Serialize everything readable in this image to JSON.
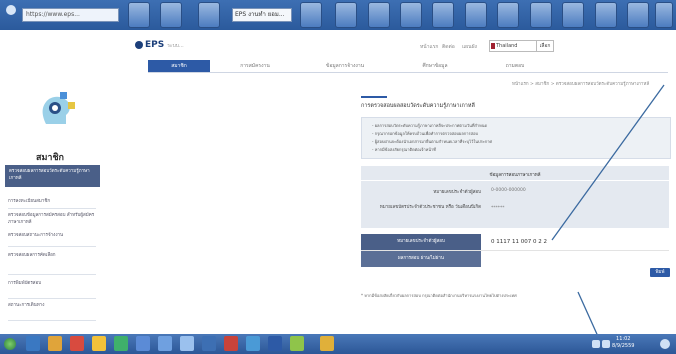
{
  "browser": {
    "address_text": "https://www.eps...",
    "tab_text": "EPS งานทำ ยอม..."
  },
  "header": {
    "logo_text": "EPS",
    "logo_sub": "ระบบ...",
    "links": [
      "หน้าแรก",
      "ติดต่อ",
      "แผนผัง"
    ],
    "language": "Thailand",
    "language_button": "เลือก"
  },
  "nav": {
    "items": [
      "สมาชิก",
      "การสมัครงาน",
      "ข้อมูลการจ้างงาน",
      "ศึกษาข้อมูล",
      "ถามตอบ"
    ]
  },
  "breadcrumb": "หน้าแรก > สมาชิก > ตรวจสอบผลการสอบวัดระดับความรู้ภาษาเกาหลี",
  "sidebar": {
    "heading": "สมาชิก",
    "active_item": "ตรวจสอบผลการสอบวัดระดับความรู้ภาษาเกาหลี",
    "items": [
      "การลงทะเบียนสมาชิก",
      "ตรวจสอบข้อมูลการสมัครสอบ สำหรับผู้สมัคร ภาษาเกาหลี",
      "ตรวจสอบสถานะการจ้างงาน",
      "ตรวจสอบผลการคัดเลือก",
      "การพิมพ์บัตรสอบ",
      "สถานะการเดินทาง"
    ]
  },
  "main": {
    "title": "การตรวจสอบผลสอบวัดระดับความรู้ภาษาเกาหลี",
    "info_lines": [
      "- ผลการสอบวัดระดับความรู้ภาษาเกาหลีจะประกาศตามวันที่กำหนด",
      "- กรุณากรอกข้อมูลให้ครบถ้วนเพื่อทำการตรวจสอบผลการสอบ",
      "- ผู้สอบผ่านจะต้องนำเอกสารมายื่นตามกำหนดเวลาที่ระบุไว้ในประกาศ",
      "- หากมีข้อสงสัยกรุณาติดต่อเจ้าหน้าที่"
    ],
    "form": {
      "heading": "ข้อมูลการสอบภาษาเกาหลี",
      "label_exam_no": "หมายเลขประจำตัวผู้สอบ",
      "value_exam_no": "0-0000-000000",
      "label_birth": "หมายเลขบัตรประจำตัวประชาชน หรือ วันเดือนปีเกิด",
      "value_birth": "******"
    },
    "result": {
      "label_reg": "หมายเลขประจำตัวผู้สอบ",
      "value_reg": "0 1117 11 007 0 2 2",
      "label_status": "ผลการสอบ  ผ่าน/ไม่ผ่าน"
    },
    "print_button": "พิมพ์",
    "footnote": "* หากมีข้อสงสัยเกี่ยวกับผลการสอบ กรุณาติดต่อสำนักงานบริหารแรงงานไทยไปต่างประเทศ"
  },
  "taskbar": {
    "time": "11:02",
    "date": "8/9/2559"
  }
}
